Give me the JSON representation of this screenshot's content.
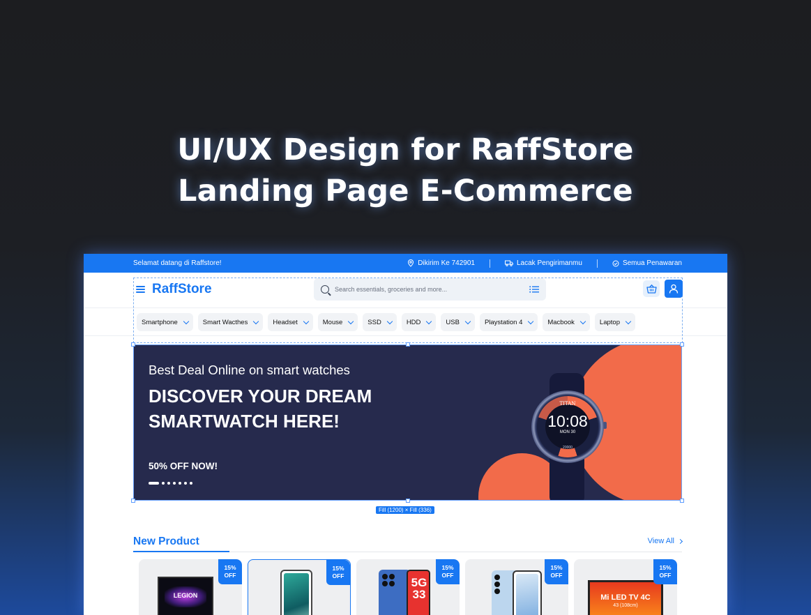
{
  "hero": {
    "line1": "UI/UX Design for RaffStore",
    "line2": "Landing Page E-Commerce"
  },
  "topbar": {
    "welcome": "Selamat datang di Raffstore!",
    "delivery": "Dikirim Ke 742901",
    "track": "Lacak Pengirimanmu",
    "offers": "Semua Penawaran"
  },
  "header": {
    "brand": "RaffStore",
    "search_placeholder": "Search essentials, groceries and more..."
  },
  "categories": [
    "Smartphone",
    "Smart Wacthes",
    "Headset",
    "Mouse",
    "SSD",
    "HDD",
    "USB",
    "Playstation 4",
    "Macbook",
    "Laptop"
  ],
  "banner": {
    "subtitle": "Best Deal Online on smart watches",
    "title": "DISCOVER YOUR DREAM SMARTWATCH HERE!",
    "offer": "50% OFF NOW!",
    "slide_count": 7,
    "active_slide": 1,
    "watch_brand": "TITAN",
    "watch_time": "10:08",
    "watch_date": "MON 30",
    "watch_steps": "20000"
  },
  "selection_label": "Fill (1200) × Fill (336)",
  "new_product": {
    "title": "New Product",
    "view_all": "View All",
    "products": [
      {
        "badge_line1": "15%",
        "badge_line2": "OFF",
        "image": "LEGION"
      },
      {
        "badge_line1": "15%",
        "badge_line2": "OFF",
        "image": ""
      },
      {
        "badge_line1": "15%",
        "badge_line2": "OFF",
        "image": "5G 33"
      },
      {
        "badge_line1": "15%",
        "badge_line2": "OFF",
        "image": ""
      },
      {
        "badge_line1": "15%",
        "badge_line2": "OFF",
        "image": "Mi LED TV 4C",
        "image_sub": "43 (108cm)"
      }
    ]
  },
  "colors": {
    "accent": "#1877f2",
    "banner_bg": "#262a4d",
    "banner_accent": "#f26b4a"
  },
  "icons": [
    "location-pin-icon",
    "truck-icon",
    "check-circle-icon",
    "menu-icon",
    "search-icon",
    "list-icon",
    "basket-icon",
    "user-icon",
    "chevron-down-icon",
    "chevron-right-icon"
  ]
}
